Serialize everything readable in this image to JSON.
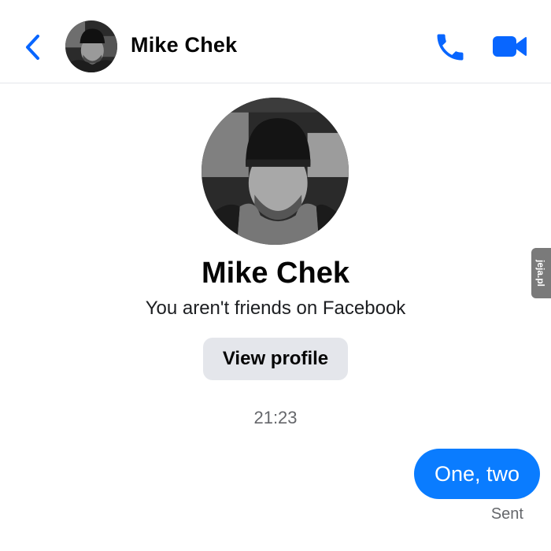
{
  "header": {
    "contact_name": "Mike Chek",
    "back_icon": "chevron-left-icon",
    "call_icon": "phone-icon",
    "video_icon": "video-camera-icon"
  },
  "profile": {
    "name": "Mike Chek",
    "friend_status": "You aren't friends on Facebook",
    "view_profile_label": "View profile"
  },
  "conversation": {
    "timestamp": "21:23",
    "messages": [
      {
        "text": "One, two",
        "direction": "outgoing",
        "status": "Sent"
      }
    ]
  },
  "watermark": {
    "text": "jeja.pl"
  },
  "colors": {
    "accent": "#0a7cff",
    "icon_blue": "#0866ff",
    "button_gray": "#e4e6eb",
    "secondary_text": "#65676b"
  }
}
